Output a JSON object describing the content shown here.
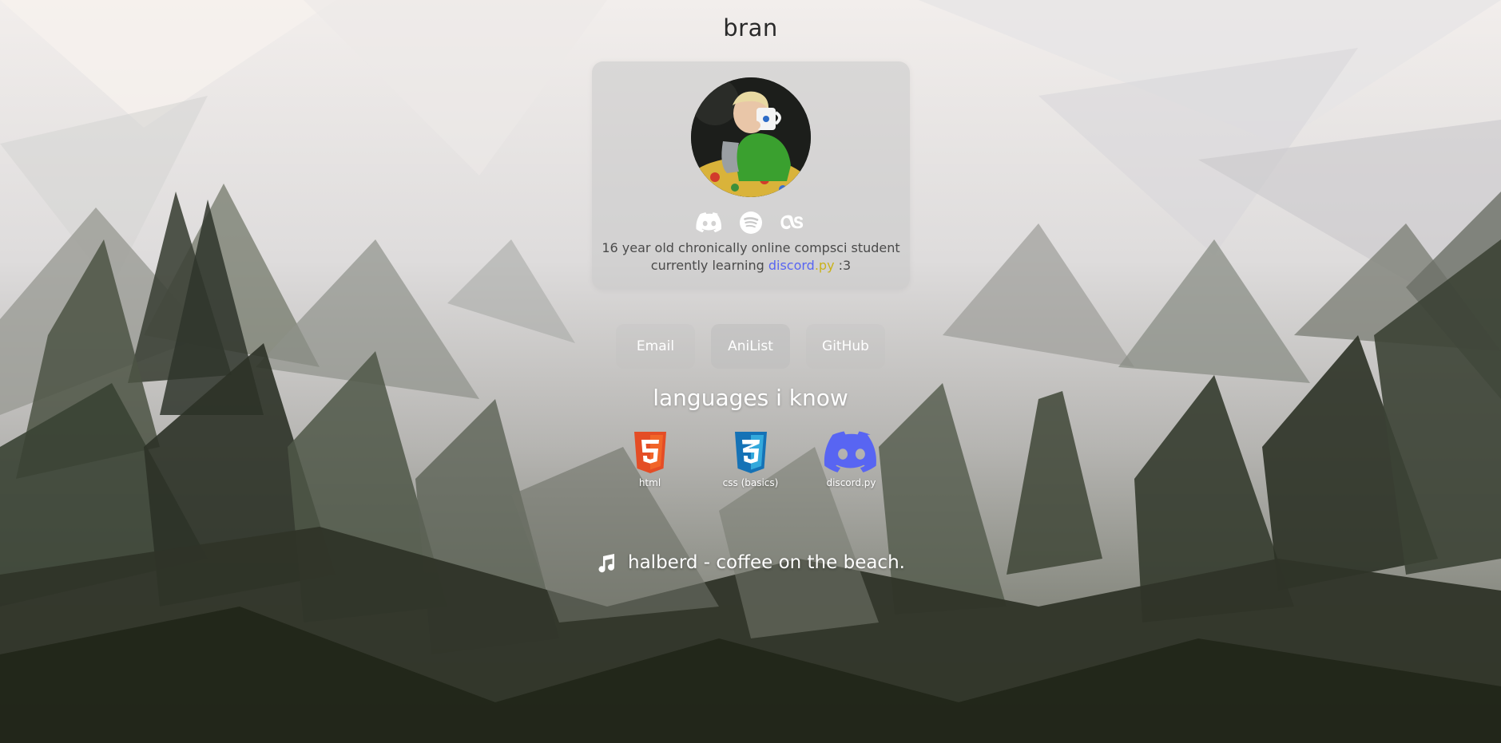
{
  "site": {
    "title": "bran"
  },
  "profile": {
    "avatar": "avatar",
    "socials": [
      {
        "name": "discord-icon"
      },
      {
        "name": "spotify-icon"
      },
      {
        "name": "lastfm-icon"
      }
    ],
    "bio_line1": "16 year old chronically online compsci student",
    "bio_prefix": "currently learning",
    "bio_discord": "discord",
    "bio_py": ".py",
    "bio_suffix": ":3"
  },
  "links": [
    {
      "label": "Email"
    },
    {
      "label": "AniList"
    },
    {
      "label": "GitHub"
    }
  ],
  "languages": {
    "title": "languages i know",
    "items": [
      {
        "label": "html",
        "icon": "html5-icon",
        "color": "#E44D26"
      },
      {
        "label": "css (basics)",
        "icon": "css3-icon",
        "color": "#1572B6"
      },
      {
        "label": "discord.py",
        "icon": "discord-icon",
        "color": "#5865F2"
      }
    ]
  },
  "now_playing": {
    "icon": "music-note-icon",
    "text": "halberd - coffee on the beach."
  },
  "colors": {
    "discord_blurple": "#5865F2",
    "py_yellow": "#c9b21b"
  }
}
